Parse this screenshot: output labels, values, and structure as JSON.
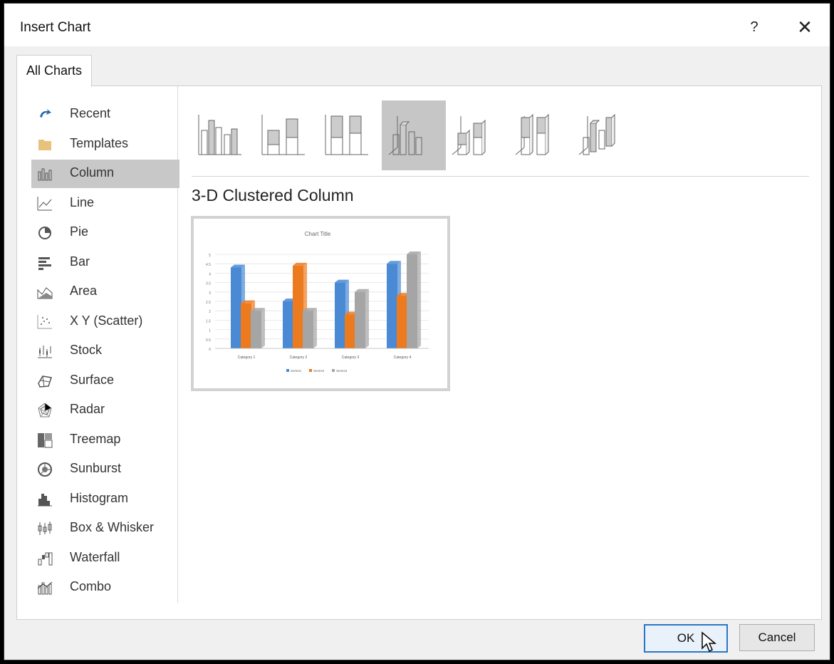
{
  "dialog": {
    "title": "Insert Chart",
    "help_label": "?",
    "close_label": "✕"
  },
  "tabs": [
    {
      "label": "All Charts",
      "selected": true
    }
  ],
  "categories": [
    {
      "label": "Recent",
      "icon": "recent-icon"
    },
    {
      "label": "Templates",
      "icon": "templates-folder-icon"
    },
    {
      "label": "Column",
      "icon": "column-chart-icon",
      "selected": true
    },
    {
      "label": "Line",
      "icon": "line-chart-icon"
    },
    {
      "label": "Pie",
      "icon": "pie-chart-icon"
    },
    {
      "label": "Bar",
      "icon": "bar-chart-icon"
    },
    {
      "label": "Area",
      "icon": "area-chart-icon"
    },
    {
      "label": "X Y (Scatter)",
      "icon": "scatter-chart-icon"
    },
    {
      "label": "Stock",
      "icon": "stock-chart-icon"
    },
    {
      "label": "Surface",
      "icon": "surface-chart-icon"
    },
    {
      "label": "Radar",
      "icon": "radar-chart-icon"
    },
    {
      "label": "Treemap",
      "icon": "treemap-chart-icon"
    },
    {
      "label": "Sunburst",
      "icon": "sunburst-chart-icon"
    },
    {
      "label": "Histogram",
      "icon": "histogram-chart-icon"
    },
    {
      "label": "Box & Whisker",
      "icon": "box-whisker-chart-icon"
    },
    {
      "label": "Waterfall",
      "icon": "waterfall-chart-icon"
    },
    {
      "label": "Combo",
      "icon": "combo-chart-icon"
    }
  ],
  "subtypes": {
    "selected_index": 3,
    "selected_name": "3-D Clustered Column",
    "count": 7
  },
  "preview_chart": {
    "title": "Chart Title",
    "y_ticks": [
      "0",
      "0.5",
      "1",
      "1.5",
      "2",
      "2.5",
      "3",
      "3.5",
      "4",
      "4.5",
      "5"
    ],
    "categories": [
      "Category 1",
      "Category 2",
      "Category 3",
      "Category 4"
    ],
    "series": [
      {
        "name": "Series1",
        "color": "#4a8ad4",
        "values": [
          4.3,
          2.5,
          3.5,
          4.5
        ]
      },
      {
        "name": "Series2",
        "color": "#ec7a1f",
        "values": [
          2.4,
          4.4,
          1.8,
          2.8
        ]
      },
      {
        "name": "Series3",
        "color": "#a5a5a5",
        "values": [
          2,
          2,
          3,
          5
        ]
      }
    ]
  },
  "buttons": {
    "ok": "OK",
    "cancel": "Cancel"
  }
}
